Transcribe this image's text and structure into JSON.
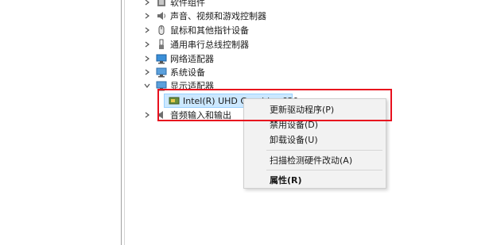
{
  "tree": {
    "items": [
      {
        "label": "软件组件",
        "expanded": false,
        "icon": "software-component-icon"
      },
      {
        "label": "声音、视频和游戏控制器",
        "expanded": false,
        "icon": "speaker-icon"
      },
      {
        "label": "鼠标和其他指针设备",
        "expanded": false,
        "icon": "mouse-icon"
      },
      {
        "label": "通用串行总线控制器",
        "expanded": false,
        "icon": "usb-icon"
      },
      {
        "label": "网络适配器",
        "expanded": false,
        "icon": "network-adapter-icon"
      },
      {
        "label": "系统设备",
        "expanded": false,
        "icon": "system-device-icon"
      },
      {
        "label": "显示适配器",
        "expanded": true,
        "icon": "display-adapter-icon"
      },
      {
        "label": "音频输入和输出",
        "expanded": false,
        "icon": "audio-io-icon"
      }
    ],
    "child": {
      "label": "Intel(R) UHD Graphics 630",
      "icon": "display-adapter-icon"
    }
  },
  "context_menu": {
    "items": [
      {
        "label": "更新驱动程序(P)"
      },
      {
        "label": "禁用设备(D)"
      },
      {
        "label": "卸载设备(U)"
      },
      {
        "label": "扫描检测硬件改动(A)"
      },
      {
        "label": "属性(R)",
        "bold": true
      }
    ]
  },
  "colors": {
    "highlight_border": "#e8101e",
    "selection_bg": "#cce8ff",
    "menu_bg": "#f2f2f2"
  }
}
